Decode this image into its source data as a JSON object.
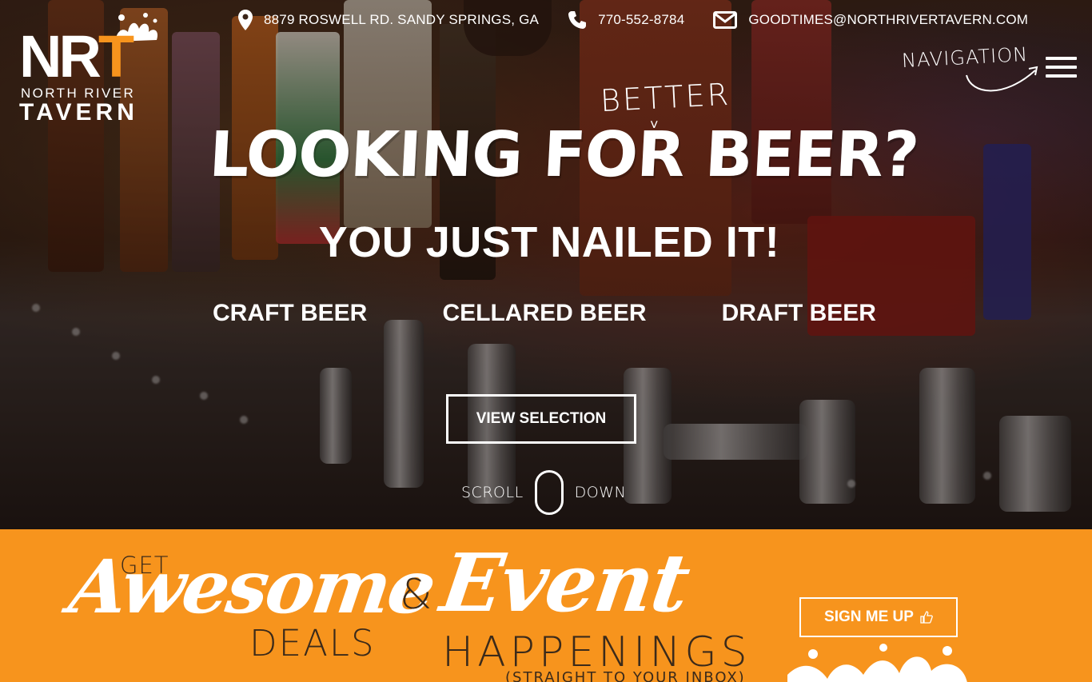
{
  "topbar": {
    "address": "8879 ROSWELL RD. SANDY SPRINGS, GA",
    "phone": "770-552-8784",
    "email": "GOODTIMES@NORTHRIVERTAVERN.COM"
  },
  "logo": {
    "letters_nr": "NR",
    "letter_t": "T",
    "line1": "NORTH RIVER",
    "line2": "TAVERN"
  },
  "nav": {
    "label": "NAVIGATION"
  },
  "hero": {
    "better": "BETTER",
    "headline": "LOOKING FOR BEER?",
    "subhead": "YOU JUST NAILED IT!",
    "categories": [
      "CRAFT BEER",
      "CELLARED BEER",
      "DRAFT BEER"
    ],
    "cta": "VIEW SELECTION",
    "scroll_left": "SCROLL",
    "scroll_right": "DOWN"
  },
  "promo": {
    "get": "GET",
    "awesome": "Awesome",
    "deals": "DEALS",
    "amp": "&",
    "event": "Event",
    "happenings": "HAPPENINGS",
    "inbox": "(STRAIGHT TO YOUR INBOX)",
    "signup": "SIGN ME UP"
  },
  "colors": {
    "accent": "#f7941d",
    "dark_text": "#3b2a1a"
  }
}
